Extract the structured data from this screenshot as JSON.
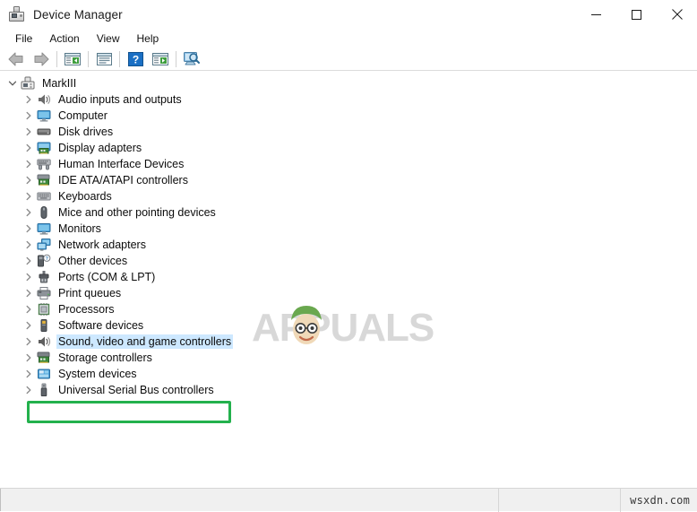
{
  "window": {
    "title": "Device Manager",
    "title_icon": "device-manager-icon",
    "controls": {
      "minimize": "minimize-icon",
      "maximize": "maximize-icon",
      "close": "close-icon"
    }
  },
  "menu": {
    "items": [
      {
        "label": "File"
      },
      {
        "label": "Action"
      },
      {
        "label": "View"
      },
      {
        "label": "Help"
      }
    ]
  },
  "toolbar": {
    "buttons": [
      {
        "name": "back-button",
        "icon": "back-arrow-icon"
      },
      {
        "name": "forward-button",
        "icon": "forward-arrow-icon"
      },
      {
        "name": "separator-1",
        "icon": "separator"
      },
      {
        "name": "show-hide-console-tree-button",
        "icon": "console-tree-icon"
      },
      {
        "name": "separator-2",
        "icon": "separator"
      },
      {
        "name": "properties-button",
        "icon": "properties-icon"
      },
      {
        "name": "separator-3",
        "icon": "separator"
      },
      {
        "name": "help-button",
        "icon": "help-question-icon"
      },
      {
        "name": "update-driver-button",
        "icon": "update-driver-icon"
      },
      {
        "name": "separator-4",
        "icon": "separator"
      },
      {
        "name": "scan-for-hardware-changes-button",
        "icon": "scan-hardware-icon"
      }
    ]
  },
  "tree": {
    "root": {
      "label": "MarkIII",
      "icon": "computer-root-icon",
      "expanded": true
    },
    "items": [
      {
        "label": "Audio inputs and outputs",
        "icon": "speaker-icon"
      },
      {
        "label": "Computer",
        "icon": "monitor-icon"
      },
      {
        "label": "Disk drives",
        "icon": "disk-drive-icon"
      },
      {
        "label": "Display adapters",
        "icon": "display-adapter-icon"
      },
      {
        "label": "Human Interface Devices",
        "icon": "hid-icon"
      },
      {
        "label": "IDE ATA/ATAPI controllers",
        "icon": "ide-controller-icon"
      },
      {
        "label": "Keyboards",
        "icon": "keyboard-icon"
      },
      {
        "label": "Mice and other pointing devices",
        "icon": "mouse-icon"
      },
      {
        "label": "Monitors",
        "icon": "monitor-icon"
      },
      {
        "label": "Network adapters",
        "icon": "network-adapter-icon"
      },
      {
        "label": "Other devices",
        "icon": "unknown-device-icon"
      },
      {
        "label": "Ports (COM & LPT)",
        "icon": "port-icon"
      },
      {
        "label": "Print queues",
        "icon": "printer-icon"
      },
      {
        "label": "Processors",
        "icon": "processor-icon"
      },
      {
        "label": "Software devices",
        "icon": "software-device-icon"
      },
      {
        "label": "Sound, video and game controllers",
        "icon": "speaker-icon",
        "selected": true,
        "highlighted": true
      },
      {
        "label": "Storage controllers",
        "icon": "storage-controller-icon"
      },
      {
        "label": "System devices",
        "icon": "system-device-icon"
      },
      {
        "label": "Universal Serial Bus controllers",
        "icon": "usb-icon"
      }
    ]
  },
  "annotation": {
    "highlight_color": "#23b14d",
    "selection_color": "#cde8ff"
  },
  "watermarks": {
    "center_logo_text": "APPUALS",
    "statusbar_text": "wsxdn.com"
  }
}
